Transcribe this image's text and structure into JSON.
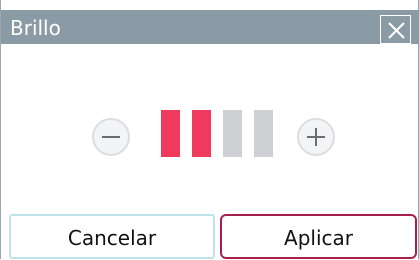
{
  "dialog": {
    "title": "Brillo",
    "close_icon": "close-icon",
    "decrease_icon": "minus-icon",
    "increase_icon": "plus-icon",
    "brightness_level": 2,
    "brightness_max": 4,
    "colors": {
      "title_bar": "#8a9ba6",
      "active_bar": "#ef3a5d",
      "inactive_bar": "#cfd0d3",
      "apply_border": "#a5204a"
    }
  },
  "buttons": {
    "cancel_label": "Cancelar",
    "apply_label": "Aplicar"
  }
}
